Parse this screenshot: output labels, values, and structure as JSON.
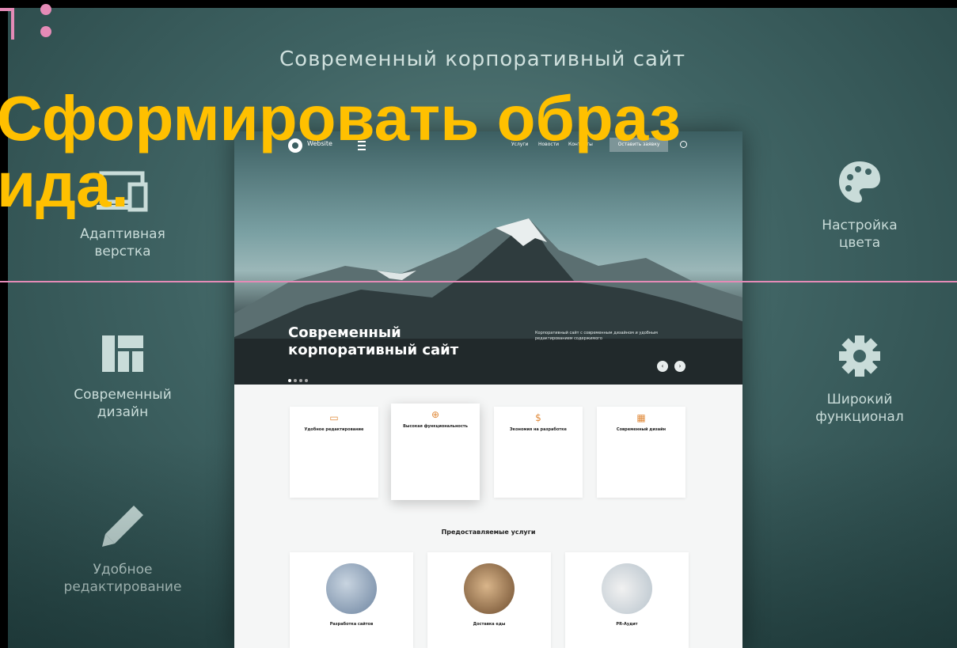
{
  "top_title": "Современный корпоративный сайт",
  "headline_line1": "Сформировать  образ",
  "headline_line2": "ида.",
  "features_left": [
    {
      "label_l1": "Адаптивная",
      "label_l2": "верстка",
      "icon": "devices-icon"
    },
    {
      "label_l1": "Современный",
      "label_l2": "дизайн",
      "icon": "layout-icon"
    },
    {
      "label_l1": "Удобное",
      "label_l2": "редактирование",
      "icon": "pencil-icon"
    }
  ],
  "features_right": [
    {
      "label_l1": "Настройка",
      "label_l2": "цвета",
      "icon": "palette-icon"
    },
    {
      "label_l1": "Широкий",
      "label_l2": "функционал",
      "icon": "gear-icon"
    }
  ],
  "mockup": {
    "logo": "Website",
    "nav_links": [
      "Услуги",
      "Новости",
      "Контакты"
    ],
    "nav_button": "Оставить заявку",
    "hero_title_l1": "Современный",
    "hero_title_l2": "корпоративный сайт",
    "hero_desc": "Корпоративный сайт с современным дизайном и удобным редактированием содержимого",
    "cards": [
      {
        "title": "Удобное редактирование",
        "icon": "▭"
      },
      {
        "title": "Высокая функциональность",
        "icon": "⊕"
      },
      {
        "title": "Экономия на разработке",
        "icon": "$"
      },
      {
        "title": "Современный дизайн",
        "icon": "▦"
      }
    ],
    "services_title": "Предоставляемые услуги",
    "services": [
      {
        "title": "Разработка сайтов"
      },
      {
        "title": "Доставка еды"
      },
      {
        "title": "PR-Аудит"
      }
    ]
  },
  "colors": {
    "headline": "#ffc000",
    "accent_line": "#e58bb7",
    "card_icon": "#e08a3a"
  }
}
